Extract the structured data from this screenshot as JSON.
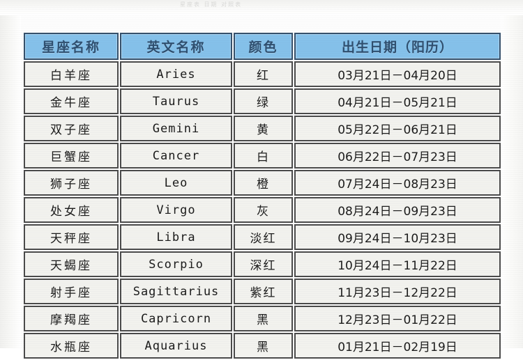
{
  "page": {
    "background_color": "#fdfdfd",
    "top_artifact_text": "星座表 日期 对照表"
  },
  "table": {
    "name": "zodiac-sign-table",
    "header_background": "#85c1ea",
    "header_text_color": "#2f4f6f",
    "row_background": "#f2f2ee",
    "border_color": "#4a4a4a",
    "columns": [
      {
        "key": "cn_name",
        "label": "星座名称"
      },
      {
        "key": "en_name",
        "label": "英文名称"
      },
      {
        "key": "color",
        "label": "颜色"
      },
      {
        "key": "birthday",
        "label": "出生日期（阳历）"
      }
    ],
    "rows": [
      {
        "cn_name": "白羊座",
        "en_name": "Aries",
        "color": "红",
        "birthday": "03月21日－04月20日"
      },
      {
        "cn_name": "金牛座",
        "en_name": "Taurus",
        "color": "绿",
        "birthday": "04月21日－05月21日"
      },
      {
        "cn_name": "双子座",
        "en_name": "Gemini",
        "color": "黄",
        "birthday": "05月22日－06月21日"
      },
      {
        "cn_name": "巨蟹座",
        "en_name": "Cancer",
        "color": "白",
        "birthday": "06月22日－07月23日"
      },
      {
        "cn_name": "狮子座",
        "en_name": "Leo",
        "color": "橙",
        "birthday": "07月24日－08月23日"
      },
      {
        "cn_name": "处女座",
        "en_name": "Virgo",
        "color": "灰",
        "birthday": "08月24日－09月23日"
      },
      {
        "cn_name": "天秤座",
        "en_name": "Libra",
        "color": "淡红",
        "birthday": "09月24日－10月23日"
      },
      {
        "cn_name": "天蝎座",
        "en_name": "Scorpio",
        "color": "深红",
        "birthday": "10月24日－11月22日"
      },
      {
        "cn_name": "射手座",
        "en_name": "Sagittarius",
        "color": "紫红",
        "birthday": "11月23日－12月22日"
      },
      {
        "cn_name": "摩羯座",
        "en_name": "Capricorn",
        "color": "黑",
        "birthday": "12月23日－01月22日"
      },
      {
        "cn_name": "水瓶座",
        "en_name": "Aquarius",
        "color": "黑",
        "birthday": "01月21日－02月19日"
      }
    ]
  }
}
